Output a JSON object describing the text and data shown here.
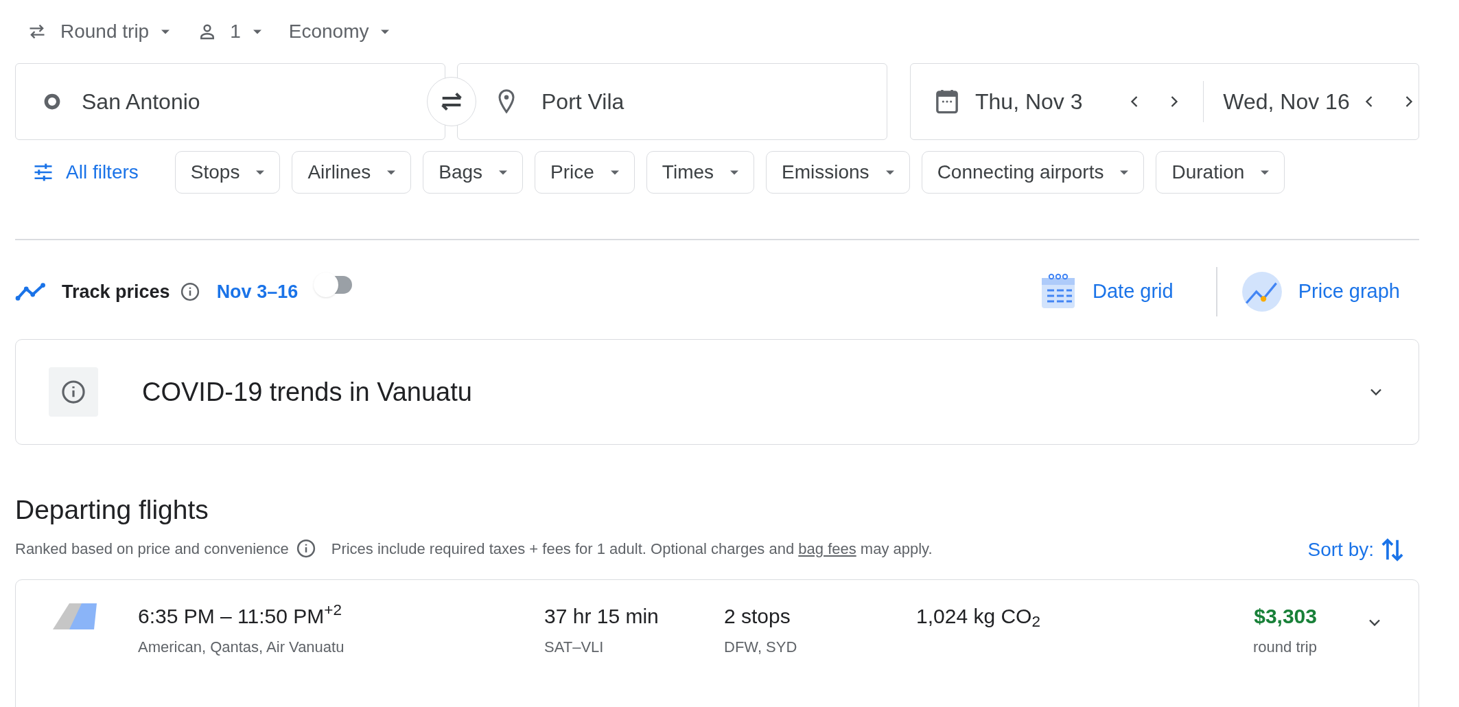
{
  "trip_options": [
    {
      "kind": "trip",
      "label": "Round trip"
    },
    {
      "kind": "passengers",
      "label": "1"
    },
    {
      "kind": "cabin",
      "label": "Economy"
    }
  ],
  "origin": {
    "value": "San Antonio"
  },
  "destination": {
    "value": "Port Vila"
  },
  "dates": [
    {
      "value": "Thu, Nov 3"
    },
    {
      "value": "Wed, Nov 16"
    }
  ],
  "all_filters": "All filters",
  "filters": [
    "Stops",
    "Airlines",
    "Bags",
    "Price",
    "Times",
    "Emissions",
    "Connecting airports",
    "Duration"
  ],
  "track_prices": {
    "label": "Track prices",
    "dates": "Nov 3–16",
    "on": false
  },
  "views": [
    {
      "kind": "date_grid",
      "label": "Date grid"
    },
    {
      "kind": "price_graph",
      "label": "Price graph"
    }
  ],
  "covid": {
    "title": "COVID-19 trends in Vanuatu",
    "expanded": false
  },
  "departing": {
    "title": "Departing flights",
    "ranked": "Ranked based on price and convenience",
    "note_before": "Prices include required taxes + fees for 1 adult. Optional charges and",
    "note_link": "bag fees",
    "note_after": "may apply.",
    "sort": "Sort by:"
  },
  "flights": [
    {
      "times": "6:35 PM – 11:50 PM$^{+2}$",
      "airlines": "American, Qantas, Air Vanuatu",
      "duration": "37 hr 15 min",
      "route": "SAT–VLI",
      "stops": "2 stops",
      "stop_airports": "DFW, SYD",
      "emissions": "1,024 kg CO$_{2}$",
      "price": "$3,303",
      "price_note": "round trip",
      "expanded": false
    }
  ]
}
